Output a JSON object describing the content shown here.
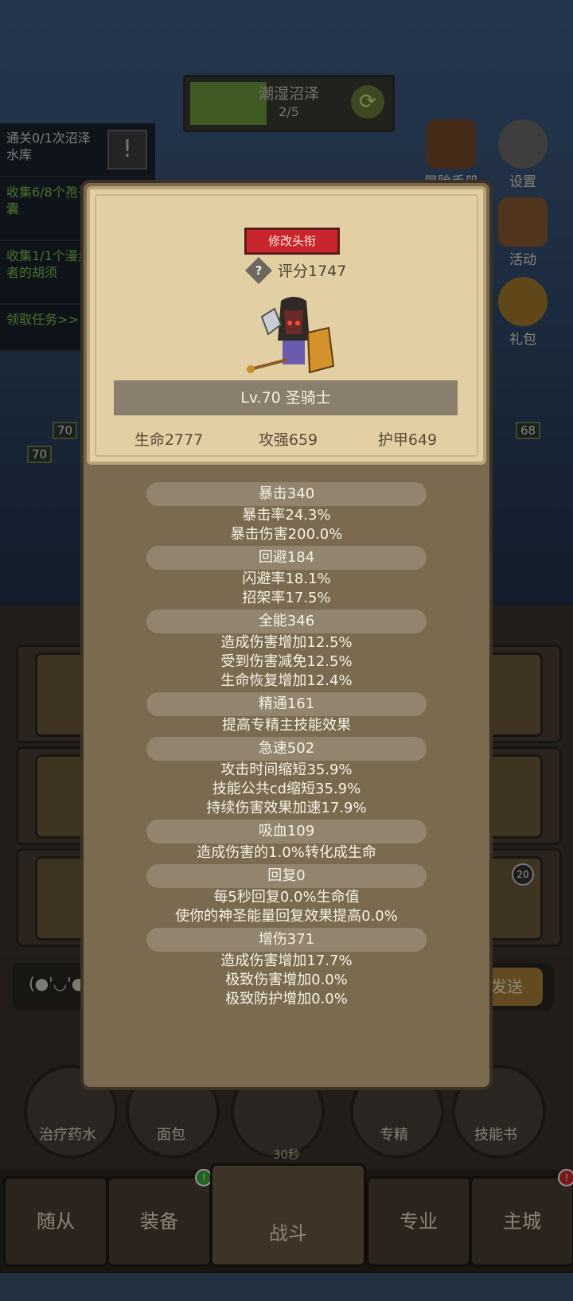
{
  "zone": {
    "title": "潮湿沼泽",
    "progress": "2/5"
  },
  "quests": [
    {
      "text": "通关0/1次沼泽水库"
    },
    {
      "text": "收集6/8个孢子囊"
    },
    {
      "text": "收集1/1个漫步者的胡须"
    },
    {
      "text": "领取任务>>"
    }
  ],
  "side_buttons": [
    {
      "label": "冒险手册",
      "icon": "book-icon"
    },
    {
      "label": "设置",
      "icon": "gear-icon"
    },
    {
      "label": "活动",
      "icon": "calendar-icon"
    },
    {
      "label": "礼包",
      "icon": "gift-icon"
    }
  ],
  "levels": {
    "a": "70",
    "b": "70",
    "enemy": "68"
  },
  "skill_badge": "20",
  "chat": {
    "face": "(●'◡'●",
    "send": "发送"
  },
  "items": [
    {
      "label": "治疗药水"
    },
    {
      "label": "面包"
    },
    {
      "label": "专精"
    },
    {
      "label": "技能书"
    }
  ],
  "timer": "30秒",
  "tabs": [
    {
      "label": "随从"
    },
    {
      "label": "装备"
    },
    {
      "label": "战斗"
    },
    {
      "label": "专业"
    },
    {
      "label": "主城"
    }
  ],
  "dialog": {
    "title_button": "修改头衔",
    "score": "评分1747",
    "name": "Lv.70 圣骑士",
    "base_stats": [
      "生命2777",
      "攻强659",
      "护甲649"
    ],
    "groups": [
      {
        "head": "暴击340",
        "lines": [
          "暴击率24.3%",
          "暴击伤害200.0%"
        ]
      },
      {
        "head": "回避184",
        "lines": [
          "闪避率18.1%",
          "招架率17.5%"
        ]
      },
      {
        "head": "全能346",
        "lines": [
          "造成伤害增加12.5%",
          "受到伤害减免12.5%",
          "生命恢复增加12.4%"
        ]
      },
      {
        "head": "精通161",
        "lines": [
          "提高专精主技能效果"
        ]
      },
      {
        "head": "急速502",
        "lines": [
          "攻击时间缩短35.9%",
          "技能公共cd缩短35.9%",
          "持续伤害效果加速17.9%"
        ]
      },
      {
        "head": "吸血109",
        "lines": [
          "造成伤害的1.0%转化成生命"
        ]
      },
      {
        "head": "回复0",
        "lines": [
          "每5秒回复0.0%生命值",
          "使你的神圣能量回复效果提高0.0%"
        ]
      },
      {
        "head": "增伤371",
        "lines": [
          "造成伤害增加17.7%",
          "极致伤害增加0.0%",
          "极致防护增加0.0%"
        ]
      }
    ]
  }
}
